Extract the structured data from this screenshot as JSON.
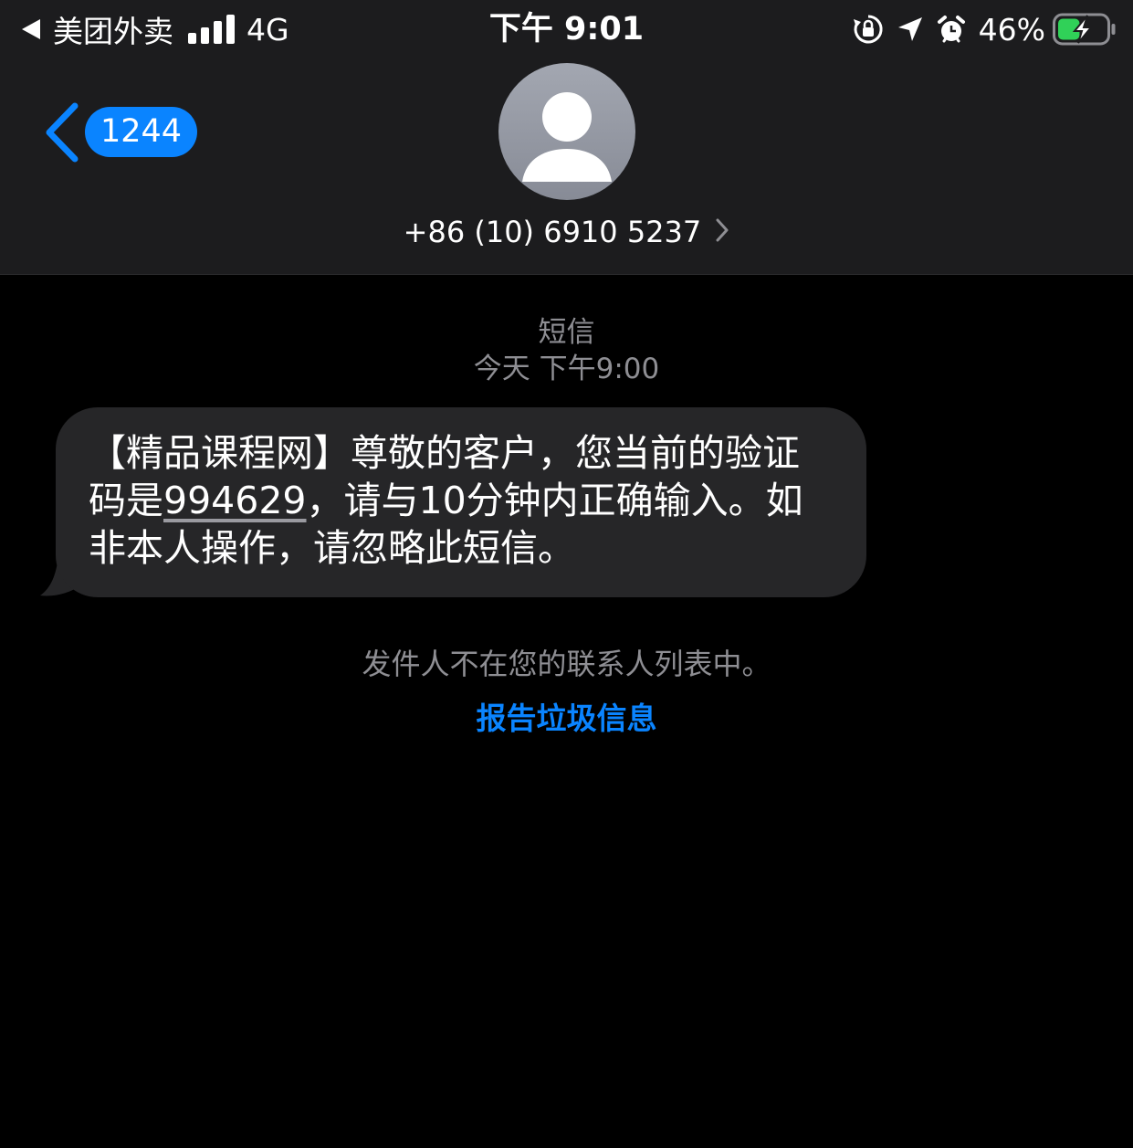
{
  "status_bar": {
    "back_app": "美团外卖",
    "network": "4G",
    "time": "下午 9:01",
    "battery": "46%",
    "battery_level": 0.46,
    "battery_charging": true,
    "battery_color": "#30d158",
    "icons": [
      "back-arrow-icon",
      "signal-icon",
      "orientation-lock-icon",
      "location-arrow-icon",
      "alarm-icon",
      "battery-icon"
    ]
  },
  "nav": {
    "unread_count": "1244",
    "contact_number": "+86 (10) 6910 5237",
    "icons": [
      "chevron-left-icon",
      "avatar-person-icon",
      "chevron-right-icon"
    ]
  },
  "conversation": {
    "service": "短信",
    "timestamp": "今天 下午9:00",
    "message": {
      "before_code": "【精品课程网】尊敬的客户，您当前的验证码是",
      "code": "994629",
      "after_code": "，请与10分钟内正确输入。如非本人操作，请忽略此短信。"
    },
    "sender_notice": "发件人不在您的联系人列表中。",
    "report_link": "报告垃圾信息"
  },
  "colors": {
    "accent": "#0a84ff",
    "header_bg": "#1c1c1e",
    "bubble_bg": "#262628",
    "secondary_text": "#8e8e93",
    "page_bg": "#000000"
  }
}
